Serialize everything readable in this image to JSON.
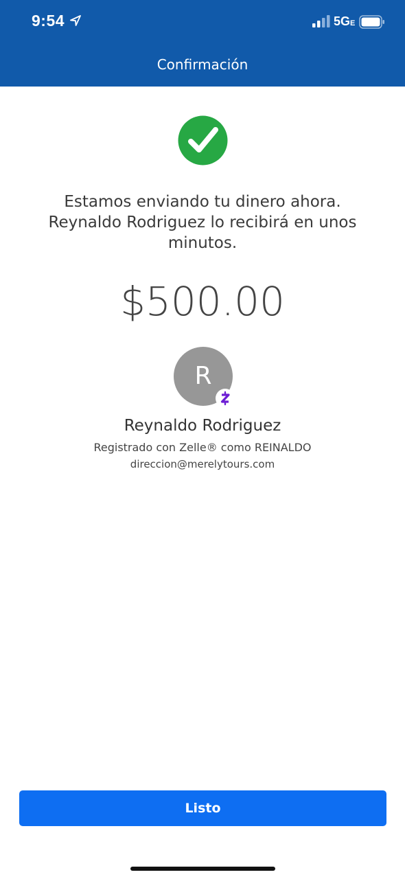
{
  "status_bar": {
    "time": "9:54",
    "network": "5G",
    "network_sub": "E",
    "icons": [
      "location-arrow-icon",
      "cellular-signal-icon",
      "battery-icon"
    ]
  },
  "header": {
    "title": "Confirmación",
    "background_color": "#115aaa"
  },
  "confirmation": {
    "icon": "checkmark-circle-icon",
    "icon_color": "#27a844",
    "message": "Estamos enviando tu dinero ahora. Reynaldo Rodriguez lo recibirá en unos minutos.",
    "amount": "$500.00"
  },
  "recipient": {
    "initial": "R",
    "badge_icon": "zelle-icon",
    "badge_color": "#6d1ed4",
    "name": "Reynaldo Rodriguez",
    "registered": "Registrado con Zelle® como REINALDO",
    "email": "direccion@merelytours.com"
  },
  "actions": {
    "done_label": "Listo",
    "button_color": "#0e6ef2"
  }
}
